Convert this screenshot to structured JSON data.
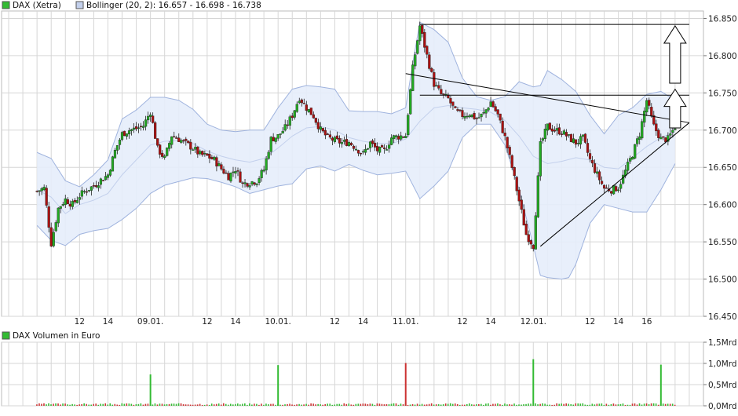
{
  "colors": {
    "up": "#22aa22",
    "down": "#aa1111",
    "band_fill": "#e6edfb",
    "band_line": "#9fb3de",
    "middle_line": "#c3d0ec",
    "grid": "#d6d6d6",
    "trendline": "#000000",
    "volume_up": "#33bb33",
    "volume_down": "#cc3333"
  },
  "legend": {
    "price_series": "DAX (Xetra)",
    "bollinger": "Bollinger (20, 2): 16.657 - 16.698 - 16.738",
    "volume": "DAX Volumen in Euro"
  },
  "chart_data": [
    {
      "type": "candlestick",
      "title": "",
      "ylim": [
        16450,
        16860
      ],
      "yticks": [
        "16.450",
        "16.500",
        "16.550",
        "16.600",
        "16.650",
        "16.700",
        "16.750",
        "16.800",
        "16.850"
      ],
      "ytick_values": [
        16450,
        16500,
        16550,
        16600,
        16650,
        16700,
        16750,
        16800,
        16850
      ],
      "xticks": [
        "12",
        "14",
        "09.01.",
        "12",
        "14",
        "10.01.",
        "12",
        "14",
        "11.01.",
        "12",
        "14",
        "12.01.",
        "12",
        "14",
        "16"
      ],
      "xtick_hours": [
        12,
        14,
        17,
        21,
        23,
        26,
        30,
        32,
        35,
        39,
        41,
        44,
        48,
        50,
        52
      ],
      "x_axis_unit": "hours since 08.01. 00:00",
      "grid": true,
      "series": [
        {
          "name": "DAX (Xetra)",
          "points": [
            [
              9.0,
              16618
            ],
            [
              9.5,
              16622
            ],
            [
              10.0,
              16548
            ],
            [
              10.5,
              16595
            ],
            [
              11.0,
              16607
            ],
            [
              11.5,
              16600
            ],
            [
              12.0,
              16612
            ],
            [
              12.5,
              16620
            ],
            [
              13.0,
              16625
            ],
            [
              13.5,
              16633
            ],
            [
              14.0,
              16640
            ],
            [
              14.5,
              16672
            ],
            [
              15.0,
              16695
            ],
            [
              15.5,
              16700
            ],
            [
              16.0,
              16702
            ],
            [
              16.5,
              16706
            ],
            [
              17.0,
              16725
            ],
            [
              17.5,
              16675
            ],
            [
              18.0,
              16662
            ],
            [
              18.5,
              16693
            ],
            [
              19.0,
              16688
            ],
            [
              19.5,
              16682
            ],
            [
              20.0,
              16676
            ],
            [
              20.5,
              16667
            ],
            [
              21.0,
              16665
            ],
            [
              21.5,
              16660
            ],
            [
              22.0,
              16648
            ],
            [
              22.5,
              16638
            ],
            [
              23.0,
              16648
            ],
            [
              23.5,
              16628
            ],
            [
              24.0,
              16630
            ],
            [
              24.5,
              16632
            ],
            [
              25.0,
              16647
            ],
            [
              25.5,
              16688
            ],
            [
              26.0,
              16692
            ],
            [
              26.5,
              16703
            ],
            [
              27.0,
              16720
            ],
            [
              27.5,
              16744
            ],
            [
              28.0,
              16730
            ],
            [
              28.5,
              16719
            ],
            [
              29.0,
              16700
            ],
            [
              29.5,
              16690
            ],
            [
              30.0,
              16686
            ],
            [
              30.5,
              16683
            ],
            [
              31.0,
              16684
            ],
            [
              31.5,
              16676
            ],
            [
              32.0,
              16668
            ],
            [
              32.5,
              16683
            ],
            [
              33.0,
              16673
            ],
            [
              33.5,
              16672
            ],
            [
              34.0,
              16690
            ],
            [
              35.0,
              16693
            ],
            [
              35.5,
              16783
            ],
            [
              36.0,
              16840
            ],
            [
              36.5,
              16800
            ],
            [
              37.0,
              16762
            ],
            [
              37.5,
              16748
            ],
            [
              38.0,
              16742
            ],
            [
              38.5,
              16725
            ],
            [
              39.0,
              16720
            ],
            [
              39.5,
              16722
            ],
            [
              40.0,
              16715
            ],
            [
              40.5,
              16722
            ],
            [
              41.0,
              16738
            ],
            [
              41.5,
              16720
            ],
            [
              42.0,
              16690
            ],
            [
              42.5,
              16650
            ],
            [
              43.0,
              16605
            ],
            [
              43.5,
              16560
            ],
            [
              44.0,
              16545
            ],
            [
              44.5,
              16680
            ],
            [
              45.0,
              16705
            ],
            [
              45.5,
              16700
            ],
            [
              46.0,
              16698
            ],
            [
              46.5,
              16690
            ],
            [
              47.0,
              16683
            ],
            [
              47.5,
              16689
            ],
            [
              48.0,
              16660
            ],
            [
              48.5,
              16640
            ],
            [
              49.0,
              16622
            ],
            [
              49.5,
              16620
            ],
            [
              50.0,
              16623
            ],
            [
              50.5,
              16645
            ],
            [
              51.0,
              16668
            ],
            [
              51.5,
              16695
            ],
            [
              52.0,
              16740
            ],
            [
              52.5,
              16705
            ],
            [
              53.0,
              16688
            ],
            [
              53.5,
              16688
            ],
            [
              54.0,
              16705
            ]
          ]
        },
        {
          "name": "Bollinger (20, 2)",
          "upper": [
            [
              9.0,
              16670
            ],
            [
              10.0,
              16662
            ],
            [
              11.0,
              16632
            ],
            [
              12.0,
              16624
            ],
            [
              13.0,
              16640
            ],
            [
              14.0,
              16660
            ],
            [
              15.0,
              16715
            ],
            [
              16.0,
              16727
            ],
            [
              17.0,
              16744
            ],
            [
              18.0,
              16744
            ],
            [
              19.0,
              16740
            ],
            [
              20.0,
              16728
            ],
            [
              21.0,
              16708
            ],
            [
              22.0,
              16700
            ],
            [
              23.0,
              16698
            ],
            [
              24.0,
              16700
            ],
            [
              25.0,
              16700
            ],
            [
              26.0,
              16730
            ],
            [
              27.0,
              16755
            ],
            [
              28.0,
              16760
            ],
            [
              29.0,
              16758
            ],
            [
              30.0,
              16755
            ],
            [
              31.0,
              16726
            ],
            [
              32.0,
              16725
            ],
            [
              33.0,
              16725
            ],
            [
              34.0,
              16722
            ],
            [
              35.0,
              16730
            ],
            [
              35.5,
              16790
            ],
            [
              36.0,
              16845
            ],
            [
              37.0,
              16835
            ],
            [
              38.0,
              16818
            ],
            [
              39.0,
              16770
            ],
            [
              40.0,
              16745
            ],
            [
              41.0,
              16740
            ],
            [
              42.0,
              16745
            ],
            [
              43.0,
              16765
            ],
            [
              44.0,
              16758
            ],
            [
              44.5,
              16760
            ],
            [
              45.0,
              16780
            ],
            [
              46.0,
              16768
            ],
            [
              47.0,
              16752
            ],
            [
              48.0,
              16720
            ],
            [
              49.0,
              16695
            ],
            [
              50.0,
              16720
            ],
            [
              51.0,
              16730
            ],
            [
              52.0,
              16748
            ],
            [
              53.0,
              16752
            ],
            [
              54.0,
              16740
            ]
          ],
          "middle": [
            [
              9.0,
              16620
            ],
            [
              10.0,
              16610
            ],
            [
              11.0,
              16588
            ],
            [
              12.0,
              16600
            ],
            [
              13.0,
              16606
            ],
            [
              14.0,
              16615
            ],
            [
              15.0,
              16640
            ],
            [
              16.0,
              16660
            ],
            [
              17.0,
              16680
            ],
            [
              18.0,
              16685
            ],
            [
              19.0,
              16686
            ],
            [
              20.0,
              16682
            ],
            [
              21.0,
              16672
            ],
            [
              22.0,
              16665
            ],
            [
              23.0,
              16660
            ],
            [
              24.0,
              16657
            ],
            [
              25.0,
              16662
            ],
            [
              26.0,
              16676
            ],
            [
              27.0,
              16692
            ],
            [
              28.0,
              16703
            ],
            [
              29.0,
              16705
            ],
            [
              30.0,
              16700
            ],
            [
              31.0,
              16690
            ],
            [
              32.0,
              16685
            ],
            [
              33.0,
              16682
            ],
            [
              34.0,
              16682
            ],
            [
              35.0,
              16688
            ],
            [
              36.0,
              16712
            ],
            [
              37.0,
              16730
            ],
            [
              38.0,
              16733
            ],
            [
              39.0,
              16730
            ],
            [
              40.0,
              16728
            ],
            [
              41.0,
              16724
            ],
            [
              42.0,
              16713
            ],
            [
              43.0,
              16692
            ],
            [
              44.0,
              16665
            ],
            [
              45.0,
              16655
            ],
            [
              46.0,
              16658
            ],
            [
              47.0,
              16663
            ],
            [
              48.0,
              16660
            ],
            [
              49.0,
              16650
            ],
            [
              50.0,
              16648
            ],
            [
              51.0,
              16663
            ],
            [
              52.0,
              16678
            ],
            [
              53.0,
              16690
            ],
            [
              54.0,
              16698
            ]
          ],
          "lower": [
            [
              9.0,
              16572
            ],
            [
              10.0,
              16552
            ],
            [
              11.0,
              16545
            ],
            [
              12.0,
              16560
            ],
            [
              13.0,
              16565
            ],
            [
              14.0,
              16568
            ],
            [
              15.0,
              16580
            ],
            [
              16.0,
              16595
            ],
            [
              17.0,
              16615
            ],
            [
              18.0,
              16626
            ],
            [
              19.0,
              16631
            ],
            [
              20.0,
              16636
            ],
            [
              21.0,
              16635
            ],
            [
              22.0,
              16630
            ],
            [
              23.0,
              16624
            ],
            [
              24.0,
              16615
            ],
            [
              25.0,
              16620
            ],
            [
              26.0,
              16625
            ],
            [
              27.0,
              16628
            ],
            [
              28.0,
              16648
            ],
            [
              29.0,
              16652
            ],
            [
              30.0,
              16645
            ],
            [
              31.0,
              16654
            ],
            [
              32.0,
              16646
            ],
            [
              33.0,
              16640
            ],
            [
              34.0,
              16642
            ],
            [
              35.0,
              16645
            ],
            [
              36.0,
              16608
            ],
            [
              37.0,
              16625
            ],
            [
              38.0,
              16645
            ],
            [
              39.0,
              16690
            ],
            [
              40.0,
              16708
            ],
            [
              41.0,
              16708
            ],
            [
              42.0,
              16680
            ],
            [
              43.0,
              16620
            ],
            [
              44.0,
              16545
            ],
            [
              44.5,
              16505
            ],
            [
              45.0,
              16502
            ],
            [
              46.0,
              16500
            ],
            [
              46.5,
              16502
            ],
            [
              47.0,
              16520
            ],
            [
              48.0,
              16575
            ],
            [
              49.0,
              16600
            ],
            [
              50.0,
              16595
            ],
            [
              51.0,
              16590
            ],
            [
              52.0,
              16590
            ],
            [
              53.0,
              16620
            ],
            [
              54.0,
              16655
            ]
          ]
        },
        {
          "name": "trendlines",
          "lines": [
            {
              "from": [
                36.0,
                16842
              ],
              "to": [
                55.0,
                16842
              ]
            },
            {
              "from": [
                36.0,
                16747
              ],
              "to": [
                55.0,
                16747
              ]
            },
            {
              "from": [
                35.0,
                16776
              ],
              "to": [
                55.0,
                16710
              ]
            },
            {
              "from": [
                44.5,
                16544
              ],
              "to": [
                55.0,
                16710
              ]
            }
          ],
          "arrows": [
            {
              "x": 54.0,
              "from": 16703,
              "to": 16755
            },
            {
              "x": 54.0,
              "from": 16763,
              "to": 16840
            }
          ]
        }
      ]
    },
    {
      "type": "bar",
      "title": "",
      "ylim": [
        0,
        1.5
      ],
      "yticks": [
        "0,0Mrd",
        "0,5Mrd",
        "1,0Mrd",
        "1,5Mrd"
      ],
      "ytick_values": [
        0,
        0.5,
        1.0,
        1.5
      ],
      "grid": true,
      "series": [
        {
          "name": "DAX Volumen in Euro",
          "spikes": [
            {
              "x": 17.0,
              "value": 0.74,
              "dir": "up"
            },
            {
              "x": 26.0,
              "value": 0.96,
              "dir": "up"
            },
            {
              "x": 35.0,
              "value": 1.01,
              "dir": "down"
            },
            {
              "x": 44.0,
              "value": 1.1,
              "dir": "up"
            },
            {
              "x": 53.0,
              "value": 0.97,
              "dir": "up"
            }
          ],
          "base_level": 0.05
        }
      ]
    }
  ]
}
